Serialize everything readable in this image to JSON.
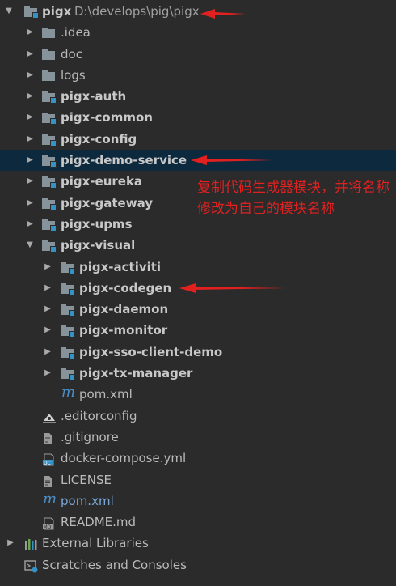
{
  "project": {
    "name": "pigx",
    "path": "D:\\develops\\pig\\pigx"
  },
  "tree": {
    "idea": ".idea",
    "doc": "doc",
    "logs": "logs",
    "auth": "pigx-auth",
    "common": "pigx-common",
    "config": "pigx-config",
    "demo_service": "pigx-demo-service",
    "eureka": "pigx-eureka",
    "gateway": "pigx-gateway",
    "upms": "pigx-upms",
    "visual": "pigx-visual",
    "activiti": "pigx-activiti",
    "codegen": "pigx-codegen",
    "daemon": "pigx-daemon",
    "monitor": "pigx-monitor",
    "sso_client_demo": "pigx-sso-client-demo",
    "tx_manager": "pigx-tx-manager",
    "visual_pom": "pom.xml",
    "editorconfig": ".editorconfig",
    "gitignore": ".gitignore",
    "docker_compose": "docker-compose.yml",
    "license": "LICENSE",
    "root_pom": "pom.xml",
    "readme": "README.md",
    "external_libraries": "External Libraries",
    "scratches": "Scratches and Consoles"
  },
  "annotation": {
    "text": "复制代码生成器模块，并将名称修改为自己的模块名称"
  },
  "colors": {
    "background": "#2b2b2b",
    "selection": "#0d293e",
    "annotation_red": "#e12020",
    "folder_gray": "#87939a",
    "module_blue": "#3592c4"
  }
}
